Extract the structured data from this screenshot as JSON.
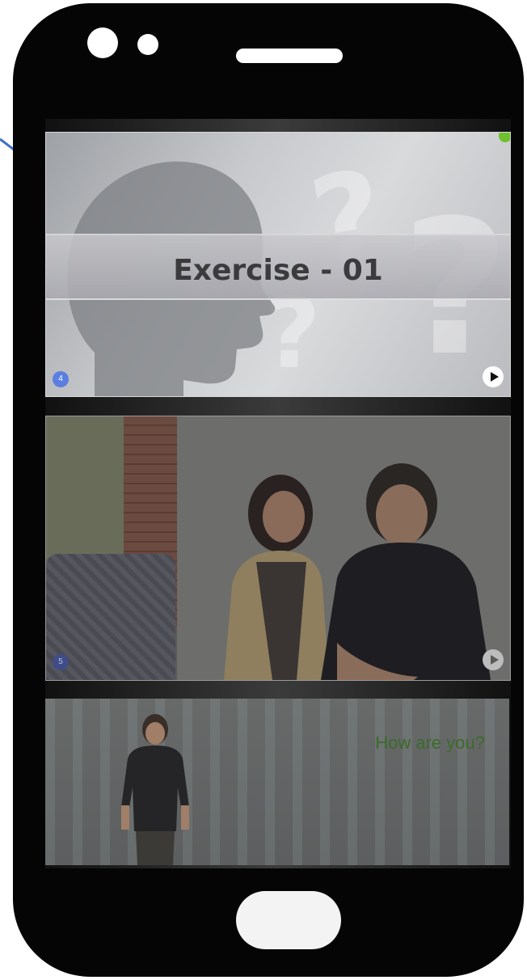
{
  "cards": [
    {
      "badge": "4",
      "title": "Exercise - 01"
    },
    {
      "badge": "5"
    },
    {
      "greeting": "How are you?"
    }
  ],
  "colors": {
    "phone_body": "#050505",
    "badge_active": "#5b7fe0",
    "greeting_text": "#3a6b2a",
    "pointer_line": "#3f72c8"
  },
  "icons": {
    "play": "play-icon",
    "pin": "pin-icon"
  }
}
